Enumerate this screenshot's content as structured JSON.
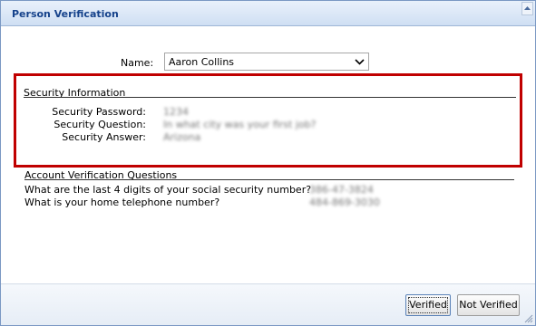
{
  "dialog": {
    "title": "Person Verification"
  },
  "name_field": {
    "label": "Name:",
    "selected": "Aaron Collins"
  },
  "security_info": {
    "section_title": "Security Information",
    "password_label": "Security Password:",
    "password_value": "1234",
    "question_label": "Security Question:",
    "question_value": "In what city was your first job?",
    "answer_label": "Security Answer:",
    "answer_value": "Arizona"
  },
  "account_verification": {
    "section_title": "Account Verification Questions",
    "questions": [
      {
        "question": "What are the last 4 digits of your social security number?",
        "answer": "386-47-3824"
      },
      {
        "question": "What is your home telephone number?",
        "answer": "484-869-3030"
      }
    ]
  },
  "buttons": {
    "verified": "Verified",
    "not_verified": "Not Verified"
  },
  "colors": {
    "title_text": "#15428b",
    "highlight_border": "#c00000"
  }
}
